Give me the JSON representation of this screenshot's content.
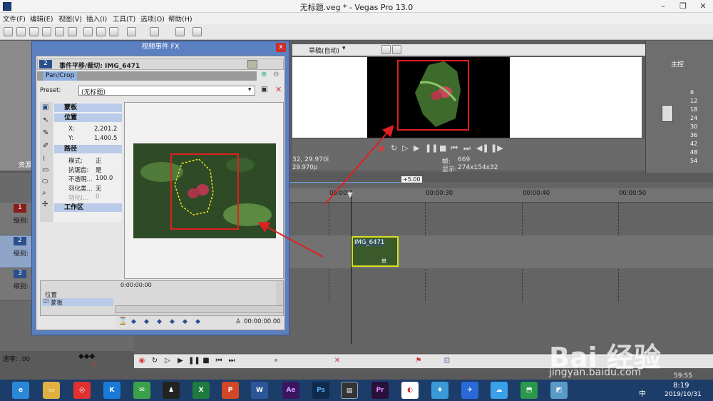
{
  "window": {
    "title": "无标题.veg * - Vegas Pro 13.0"
  },
  "menu": [
    "文件(F)",
    "编辑(E)",
    "视图(V)",
    "插入(I)",
    "工具(T)",
    "选项(O)",
    "帮助(H)"
  ],
  "explorer": {
    "tab_label": "资源"
  },
  "preview": {
    "quality": "草稿(自动)",
    "frame_label": "帧:",
    "frame_value": "669",
    "display_label": "显示:",
    "display_value": "274x154x32",
    "fps_left": "32, 29.970i",
    "fps_left2": "29.970p"
  },
  "master": {
    "label": "主控",
    "scale": [
      "6",
      "12",
      "18",
      "24",
      "30",
      "36",
      "42",
      "48",
      "54"
    ]
  },
  "timeline": {
    "offset_badge": "+5.00",
    "ticks": [
      "00:00:2",
      "00:00:30",
      "00:00:40",
      "00:00:50"
    ],
    "clip_label": "IMG_6471",
    "rate_label": "速率: .00",
    "end_time": "59:55"
  },
  "tracks": [
    {
      "num": "1",
      "level_label": "级别:"
    },
    {
      "num": "2",
      "level_label": "级别:"
    },
    {
      "num": "3",
      "level_label": "级别:"
    }
  ],
  "fx": {
    "title": "视频事件 FX",
    "event_label": "事件平移/裁切: IMG_6471",
    "track_num": "2",
    "plugin_tab": "Pan/Crop",
    "preset_label": "Preset:",
    "preset_value": "(无标题)",
    "sections": {
      "mask": "蒙板",
      "position": "位置",
      "path": "路径",
      "workspace": "工作区"
    },
    "position_props": [
      {
        "label": "X:",
        "value": "2,201.2"
      },
      {
        "label": "Y:",
        "value": "1,400.5"
      }
    ],
    "path_props": [
      {
        "label": "模式:",
        "value": "正"
      },
      {
        "label": "抗锯齿:",
        "value": "是"
      },
      {
        "label": "不透明...",
        "value": "100.0"
      },
      {
        "label": "羽化类...",
        "value": "无"
      },
      {
        "label": "羽化(...",
        "value": "0"
      }
    ],
    "keyframe_rows": [
      "位置",
      "蒙板"
    ],
    "kf_time_start": "0:00:00:00",
    "kf_time_end": "00:00:00.00"
  },
  "taskbar": {
    "time": "8:19",
    "date": "2019/10/31",
    "lang": "中"
  },
  "watermark": {
    "brand": "Bai 经验",
    "url": "jingyan.baidu.com"
  },
  "colors": {
    "dialog_border": "#5b80c2",
    "annotation_red": "#e02020",
    "clip_outline": "#d4e020",
    "taskbar": "#1c3d6a"
  }
}
